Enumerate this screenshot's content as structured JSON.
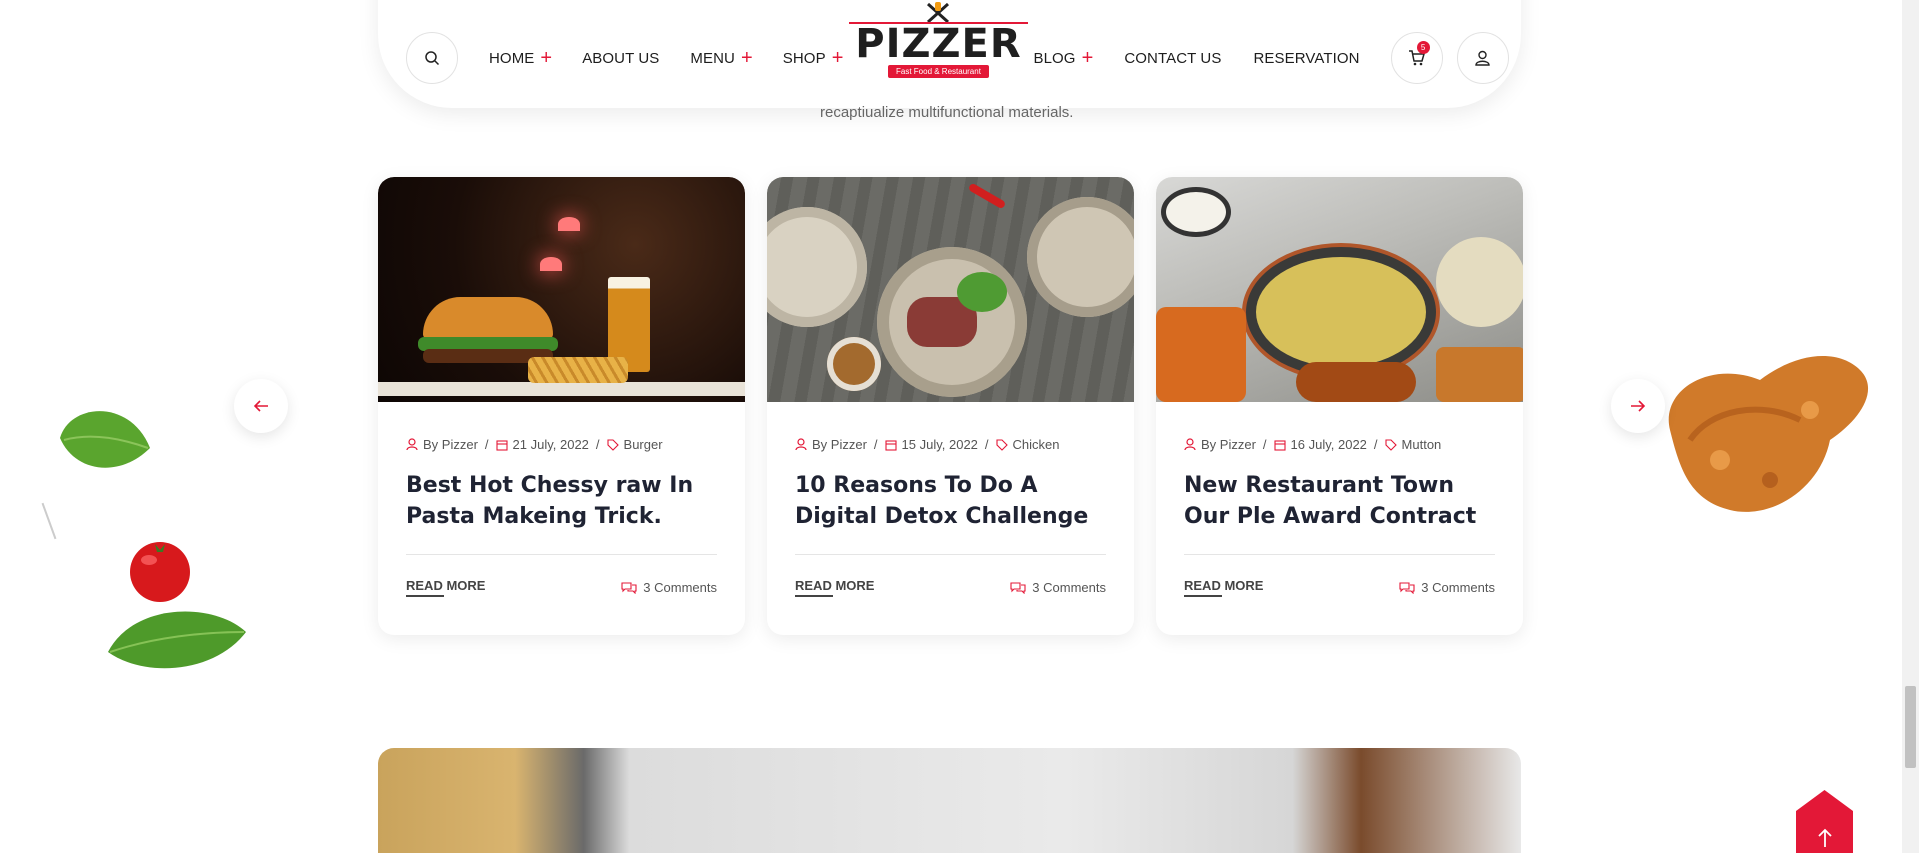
{
  "header": {
    "nav_left": [
      {
        "label": "HOME",
        "has_plus": true
      },
      {
        "label": "ABOUT US",
        "has_plus": false
      },
      {
        "label": "MENU",
        "has_plus": true
      },
      {
        "label": "SHOP",
        "has_plus": true
      }
    ],
    "nav_right": [
      {
        "label": "BLOG",
        "has_plus": true
      },
      {
        "label": "CONTACT US",
        "has_plus": false
      },
      {
        "label": "RESERVATION",
        "has_plus": false
      }
    ],
    "plus_symbol": "+",
    "logo_text": "PIZZER",
    "logo_tagline": "Fast Food & Restaurant",
    "cart_count": "5",
    "icons": {
      "search": "search-icon",
      "cart": "cart-icon",
      "user": "user-icon"
    }
  },
  "section": {
    "subtext": "recaptiualize multifunctional materials."
  },
  "posts": [
    {
      "author": "By Pizzer",
      "date": "21 July, 2022",
      "category": "Burger",
      "title": "Best Hot Chessy raw In Pasta Makeing Trick.",
      "read_more": "READ MORE",
      "comments": "3 Comments"
    },
    {
      "author": "By Pizzer",
      "date": "15 July, 2022",
      "category": "Chicken",
      "title": "10 Reasons To Do A Digital Detox Challenge",
      "read_more": "READ MORE",
      "comments": "3 Comments"
    },
    {
      "author": "By Pizzer",
      "date": "16 July, 2022",
      "category": "Mutton",
      "title": "New Restaurant Town Our Ple Award Contract",
      "read_more": "READ MORE",
      "comments": "3 Comments"
    }
  ],
  "meta_separator": "/",
  "colors": {
    "accent": "#e31837",
    "title": "#1f2333",
    "text": "#555555"
  }
}
